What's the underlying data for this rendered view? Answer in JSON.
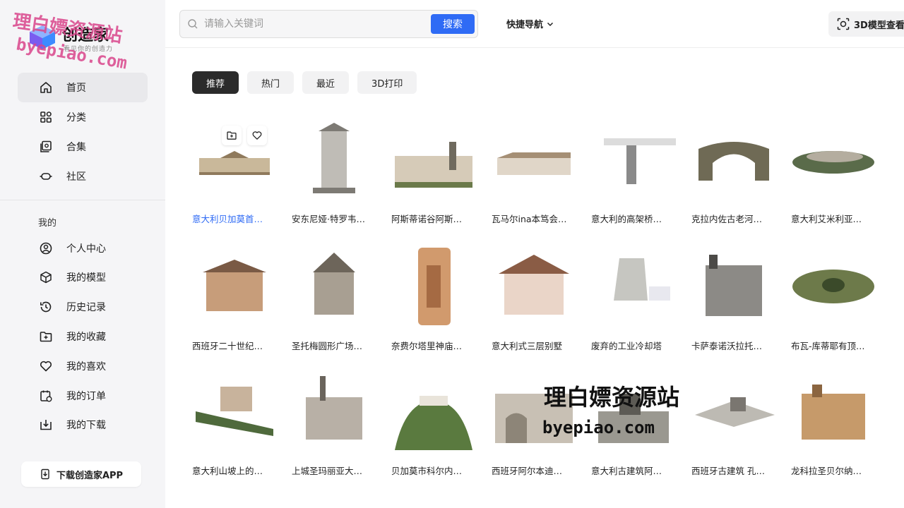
{
  "brand": {
    "name": "创造家",
    "tagline": "看见你的创造力"
  },
  "watermark": {
    "line1": "理白嫖资源站",
    "line2": "byepiao.com"
  },
  "sidebar": {
    "main_items": [
      {
        "label": "首页",
        "icon": "home-icon",
        "active": true
      },
      {
        "label": "分类",
        "icon": "grid-icon"
      },
      {
        "label": "合集",
        "icon": "collection-icon"
      },
      {
        "label": "社区",
        "icon": "community-icon"
      }
    ],
    "section_title": "我的",
    "my_items": [
      {
        "label": "个人中心",
        "icon": "user-icon"
      },
      {
        "label": "我的模型",
        "icon": "cube-icon"
      },
      {
        "label": "历史记录",
        "icon": "history-icon"
      },
      {
        "label": "我的收藏",
        "icon": "folder-icon"
      },
      {
        "label": "我的喜欢",
        "icon": "heart-icon"
      },
      {
        "label": "我的订单",
        "icon": "order-icon"
      },
      {
        "label": "我的下载",
        "icon": "download-icon"
      }
    ],
    "download_app": "下载创造家APP"
  },
  "topbar": {
    "search_placeholder": "请输入关键词",
    "search_button": "搜索",
    "quick_nav": "快捷导航",
    "model_button": "3D模型查看"
  },
  "tabs": [
    {
      "label": "推荐",
      "active": true
    },
    {
      "label": "热门"
    },
    {
      "label": "最近"
    },
    {
      "label": "3D打印"
    }
  ],
  "models": [
    {
      "title": "意大利贝加莫首…",
      "highlight": true
    },
    {
      "title": "安东尼娅·特罗韦…"
    },
    {
      "title": "阿斯蒂诺谷阿斯…"
    },
    {
      "title": "瓦马尔ina本笃会…"
    },
    {
      "title": "意大利的高架桥…"
    },
    {
      "title": "克拉内佐古老河…"
    },
    {
      "title": "意大利艾米利亚…"
    },
    {
      "title": "西班牙二十世纪…"
    },
    {
      "title": "圣托梅圆形广场…"
    },
    {
      "title": "奈费尔塔里神庙…"
    },
    {
      "title": "意大利式三层别墅"
    },
    {
      "title": "废弃的工业冷却塔"
    },
    {
      "title": "卡萨泰诺沃拉托…"
    },
    {
      "title": "布瓦-库蒂耶有顶…"
    },
    {
      "title": "意大利山坡上的…"
    },
    {
      "title": "上城圣玛丽亚大…"
    },
    {
      "title": "贝加莫市科尔内…"
    },
    {
      "title": "西班牙阿尔本迪…"
    },
    {
      "title": "意大利古建筑阿…"
    },
    {
      "title": "西班牙古建筑 孔…"
    },
    {
      "title": "龙科拉圣贝尔纳…"
    }
  ]
}
